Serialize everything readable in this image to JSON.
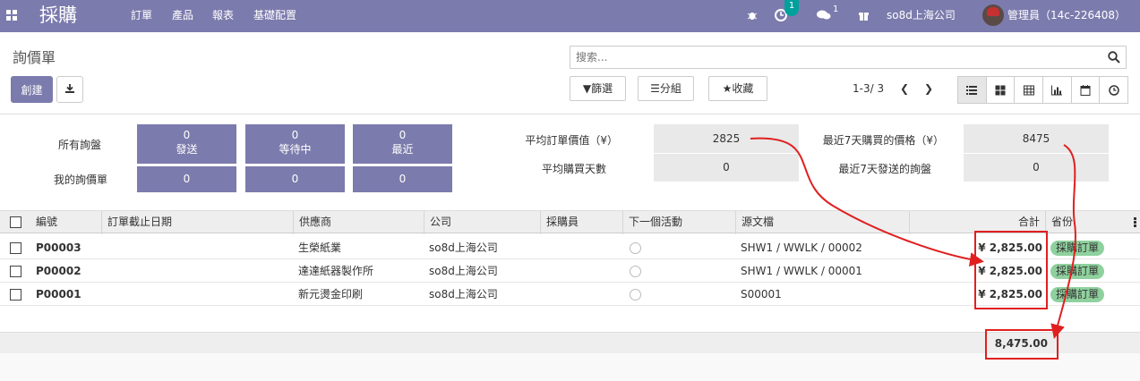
{
  "navbar": {
    "brand": "採購",
    "menu": [
      "訂單",
      "產品",
      "報表",
      "基礎配置"
    ],
    "activity_badge": "1",
    "messages_badge": "1",
    "company": "so8d上海公司",
    "user": "管理員（14c-226408）",
    "color": "#7c7bad"
  },
  "control": {
    "title": "詢價單",
    "create_label": "創建",
    "search_placeholder": "搜索...",
    "filters_label": "篩選",
    "groupby_label": "分組",
    "favorites_label": "收藏",
    "pager": "1-3/ 3"
  },
  "dashboard": {
    "all_rfq_label": "所有詢盤",
    "my_rfq_label": "我的詢價單",
    "tiles": [
      {
        "num": "0",
        "label": "發送"
      },
      {
        "num": "0",
        "label": "等待中"
      },
      {
        "num": "0",
        "label": "最近"
      }
    ],
    "my_values": [
      "0",
      "0",
      "0"
    ],
    "avg_order_label": "平均訂單價值（¥）",
    "avg_order_value": "2825",
    "avg_days_label": "平均購買天數",
    "avg_days_value": "0",
    "last7_purchased_label": "最近7天購買的價格（¥）",
    "last7_purchased_value": "8475",
    "last7_sent_label": "最近7天發送的詢盤",
    "last7_sent_value": "0"
  },
  "table": {
    "columns": [
      "編號",
      "訂單截止日期",
      "供應商",
      "公司",
      "採購員",
      "下一個活動",
      "源文檔",
      "合計",
      "省份"
    ],
    "rows": [
      {
        "ref": "P00003",
        "deadline": "",
        "vendor": "生榮紙業",
        "company": "so8d上海公司",
        "buyer": "",
        "source": "SHW1 / WWLK / 00002",
        "total": "¥ 2,825.00",
        "status": "採購訂單"
      },
      {
        "ref": "P00002",
        "deadline": "",
        "vendor": "達達紙器製作所",
        "company": "so8d上海公司",
        "buyer": "",
        "source": "SHW1 / WWLK / 00001",
        "total": "¥ 2,825.00",
        "status": "採購訂單"
      },
      {
        "ref": "P00001",
        "deadline": "",
        "vendor": "新元燙金印刷",
        "company": "so8d上海公司",
        "buyer": "",
        "source": "S00001",
        "total": "¥ 2,825.00",
        "status": "採購訂單"
      }
    ],
    "grand_total": "8,475.00"
  },
  "annotation_color": "#e02020"
}
